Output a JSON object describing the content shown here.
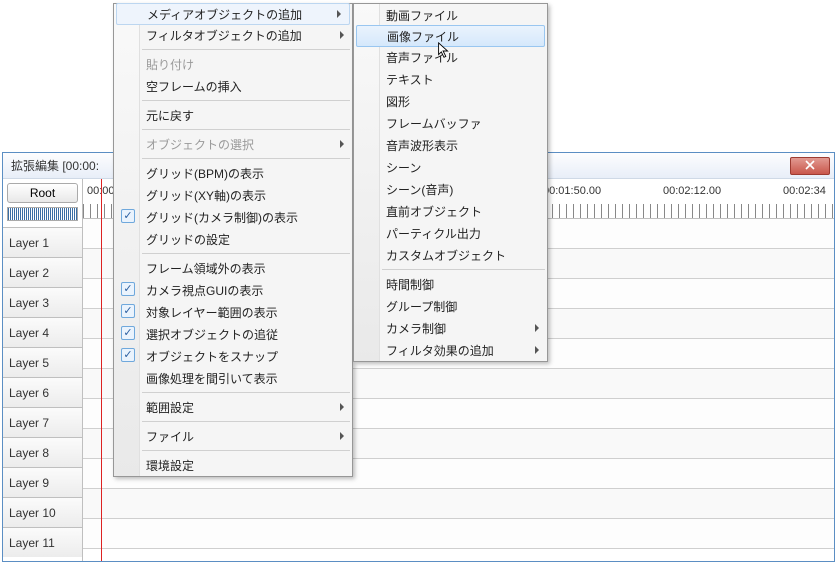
{
  "window": {
    "title": "拡張編集 [00:00:",
    "root_button": "Root",
    "ruler_labels": [
      "00:00",
      "00:01:50.00",
      "00:02:12.00",
      "00:02:34"
    ],
    "layers": [
      "Layer 1",
      "Layer 2",
      "Layer 3",
      "Layer 4",
      "Layer 5",
      "Layer 6",
      "Layer 7",
      "Layer 8",
      "Layer 9",
      "Layer 10",
      "Layer 11"
    ]
  },
  "menu1": {
    "items": [
      {
        "label": "メディアオブジェクトの追加",
        "submenu": true,
        "open": true
      },
      {
        "label": "フィルタオブジェクトの追加",
        "submenu": true
      },
      {
        "sep": true
      },
      {
        "label": "貼り付け",
        "disabled": true
      },
      {
        "label": "空フレームの挿入"
      },
      {
        "sep": true
      },
      {
        "label": "元に戻す"
      },
      {
        "sep": true
      },
      {
        "label": "オブジェクトの選択",
        "submenu": true,
        "disabled": true
      },
      {
        "sep": true
      },
      {
        "label": "グリッド(BPM)の表示"
      },
      {
        "label": "グリッド(XY軸)の表示"
      },
      {
        "label": "グリッド(カメラ制御)の表示",
        "checked": true
      },
      {
        "label": "グリッドの設定"
      },
      {
        "sep": true
      },
      {
        "label": "フレーム領域外の表示"
      },
      {
        "label": "カメラ視点GUIの表示",
        "checked": true
      },
      {
        "label": "対象レイヤー範囲の表示",
        "checked": true
      },
      {
        "label": "選択オブジェクトの追従",
        "checked": true
      },
      {
        "label": "オブジェクトをスナップ",
        "checked": true
      },
      {
        "label": "画像処理を間引いて表示"
      },
      {
        "sep": true
      },
      {
        "label": "範囲設定",
        "submenu": true
      },
      {
        "sep": true
      },
      {
        "label": "ファイル",
        "submenu": true
      },
      {
        "sep": true
      },
      {
        "label": "環境設定"
      }
    ]
  },
  "menu2": {
    "items": [
      {
        "label": "動画ファイル"
      },
      {
        "label": "画像ファイル",
        "highlight": true
      },
      {
        "label": "音声ファイル"
      },
      {
        "label": "テキスト"
      },
      {
        "label": "図形"
      },
      {
        "label": "フレームバッファ"
      },
      {
        "label": "音声波形表示"
      },
      {
        "label": "シーン"
      },
      {
        "label": "シーン(音声)"
      },
      {
        "label": "直前オブジェクト"
      },
      {
        "label": "パーティクル出力"
      },
      {
        "label": "カスタムオブジェクト"
      },
      {
        "sep": true
      },
      {
        "label": "時間制御"
      },
      {
        "label": "グループ制御"
      },
      {
        "label": "カメラ制御",
        "submenu": true
      },
      {
        "label": "フィルタ効果の追加",
        "submenu": true
      }
    ]
  }
}
